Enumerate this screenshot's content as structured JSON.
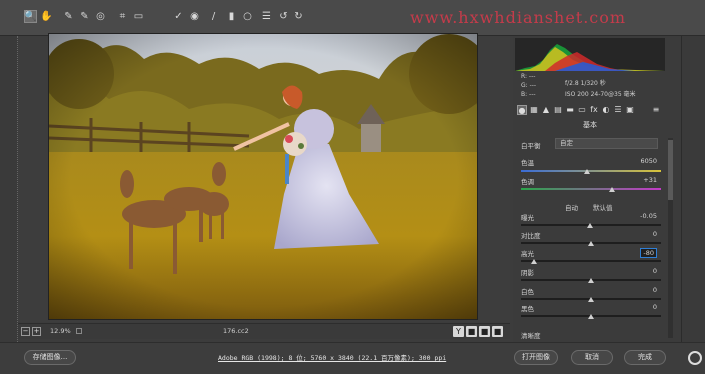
{
  "toolbar": {
    "tools": [
      {
        "name": "zoom-tool-icon",
        "glyph": "🔍"
      },
      {
        "name": "hand-tool-icon",
        "glyph": "✋"
      },
      {
        "name": "white-balance-tool-icon",
        "glyph": "✎"
      },
      {
        "name": "color-sampler-tool-icon",
        "glyph": "✎"
      },
      {
        "name": "targeted-adjustment-tool-icon",
        "glyph": "◎"
      },
      {
        "name": "crop-tool-icon",
        "glyph": "⌗"
      },
      {
        "name": "straighten-tool-icon",
        "glyph": "▭"
      },
      {
        "name": "spot-removal-tool-icon",
        "glyph": "✓"
      },
      {
        "name": "red-eye-tool-icon",
        "glyph": "◉"
      },
      {
        "name": "adjustment-brush-icon",
        "glyph": "/"
      },
      {
        "name": "graduated-filter-icon",
        "glyph": "▮"
      },
      {
        "name": "radial-filter-icon",
        "glyph": "○"
      },
      {
        "name": "preferences-icon",
        "glyph": "☰"
      },
      {
        "name": "rotate-left-icon",
        "glyph": "↺"
      },
      {
        "name": "rotate-right-icon",
        "glyph": "↻"
      }
    ],
    "watermark": "www.hxwhdianshet.com"
  },
  "status": {
    "zoom": "12.9%",
    "dimension": "176.cc2",
    "before_after": [
      "Y",
      "■",
      "■",
      "■"
    ]
  },
  "bottom": {
    "save_image": "存储图像...",
    "workflow": "Adobe RGB (1998); 8 位; 5760 x 3840 (22.1 百万像素); 300 ppi",
    "open_image": "打开图像",
    "cancel": "取消",
    "done": "完成"
  },
  "camera": {
    "r": "R: ---",
    "g": "G: ---",
    "b": "B: ---",
    "aperture_shutter": "f/2.8   1/320 秒",
    "iso_lens": "ISO 200   24-70@35 毫米"
  },
  "panel": {
    "title": "基本",
    "white_balance_label": "白平衡",
    "white_balance_value": "自定",
    "auto": "自动",
    "default": "默认值",
    "sliders": [
      {
        "key": "temp",
        "label": "色温",
        "value": "6050",
        "pos": 0.47
      },
      {
        "key": "tint",
        "label": "色调",
        "value": "+31",
        "pos": 0.65
      },
      {
        "key": "exposure",
        "label": "曝光",
        "value": "-0.05",
        "pos": 0.49
      },
      {
        "key": "contrast",
        "label": "对比度",
        "value": "0",
        "pos": 0.5
      },
      {
        "key": "highlights",
        "label": "高光",
        "value": "-80",
        "pos": 0.09
      },
      {
        "key": "shadows",
        "label": "阴影",
        "value": "0",
        "pos": 0.5
      },
      {
        "key": "whites",
        "label": "白色",
        "value": "0",
        "pos": 0.5
      },
      {
        "key": "blacks",
        "label": "黑色",
        "value": "0",
        "pos": 0.5
      },
      {
        "key": "clarity",
        "label": "清晰度",
        "value": "",
        "pos": 0.5
      }
    ]
  },
  "colors": {
    "accent": "#2f7fd6",
    "watermark": "#d23a4a"
  }
}
